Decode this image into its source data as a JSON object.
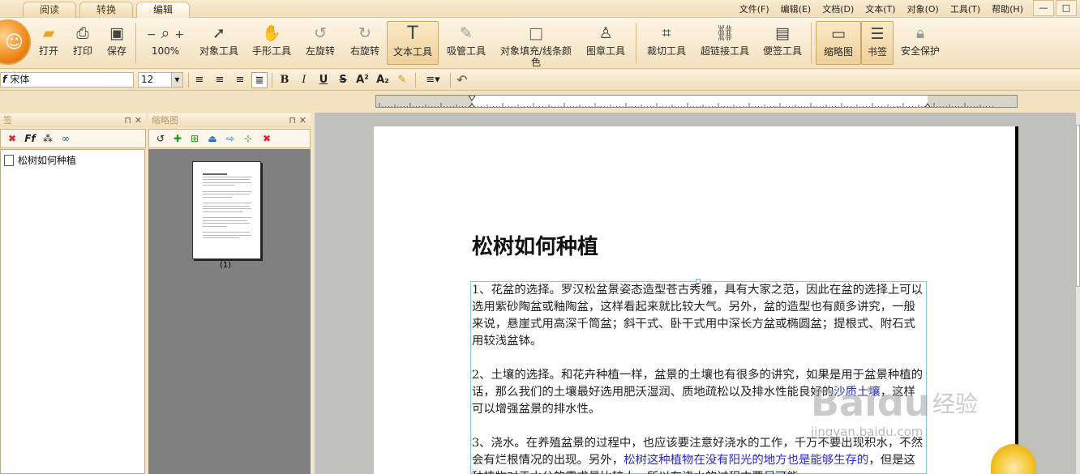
{
  "tabs": [
    "阅读",
    "转换",
    "编辑"
  ],
  "menus": [
    "文件(F)",
    "编辑(E)",
    "文档(D)",
    "文本(T)",
    "对象(O)",
    "工具(T)",
    "帮助(H)"
  ],
  "window_buttons": [
    "—",
    "□"
  ],
  "toolbar": {
    "open": "打开",
    "print": "打印",
    "save": "保存",
    "zoom": "100%",
    "zoom_minus": "−",
    "zoom_plus": "+",
    "object_tool": "对象工具",
    "hand_tool": "手形工具",
    "rotate_left": "左旋转",
    "rotate_right": "右旋转",
    "text_tool": "文本工具",
    "eyedropper_tool": "吸管工具",
    "fill_tool": "对象填充/线条颜色",
    "stamp_tool": "图章工具",
    "crop_tool": "裁切工具",
    "link_tool": "超链接工具",
    "note_tool": "便签工具",
    "thumbnail": "缩略图",
    "bookmark": "书签",
    "security": "安全保护"
  },
  "format": {
    "font": "宋体",
    "size": "12"
  },
  "panels": {
    "bookmark_header": "签",
    "thumbnail_header": "缩略图",
    "bookmark_item": "松树如何种植",
    "thumb_label": "(1)"
  },
  "document": {
    "title": "松树如何种植",
    "p1": "1、花盆的选择。罗汉松盆景姿态造型苍古秀雅，具有大家之范，因此在盆的选择上可以选用紫砂陶盆或釉陶盆，这样看起来就比较大气。另外，盆的造型也有颇多讲究，一般来说，悬崖式用高深千筒盆；斜干式、卧干式用中深长方盆或椭圆盆；提根式、附石式用较浅盆钵。",
    "p2a": "2、土壤的选择。和花卉种植一样，盆景的土壤也有很多的讲究，如果是用于盆景种植的话，那么我们的土壤最好选用肥沃湿润、质地疏松以及排水性能良好的",
    "p2b": "沙质土壤",
    "p2c": "，这样可以增强盆景的排水性。",
    "p3a": "3、浇水。在养殖盆景的过程中，也应该要注意好浇水的工作，千万不要出现积水，不然会有烂根情况的出现。另外，",
    "p3b": "松树这种植物在没有阳光的地方也是能够生存的",
    "p3c": "，但是这种植物对于水分的需求量比较大，所以在浇水的过程中要尽可能"
  },
  "watermark": {
    "brand": "Baidu",
    "cn": "经验",
    "url": "jingyan.baidu.com"
  },
  "colors": {
    "accent": "#f08a1c",
    "link_text": "#2a2ad6",
    "selection": "#82c7e6"
  }
}
